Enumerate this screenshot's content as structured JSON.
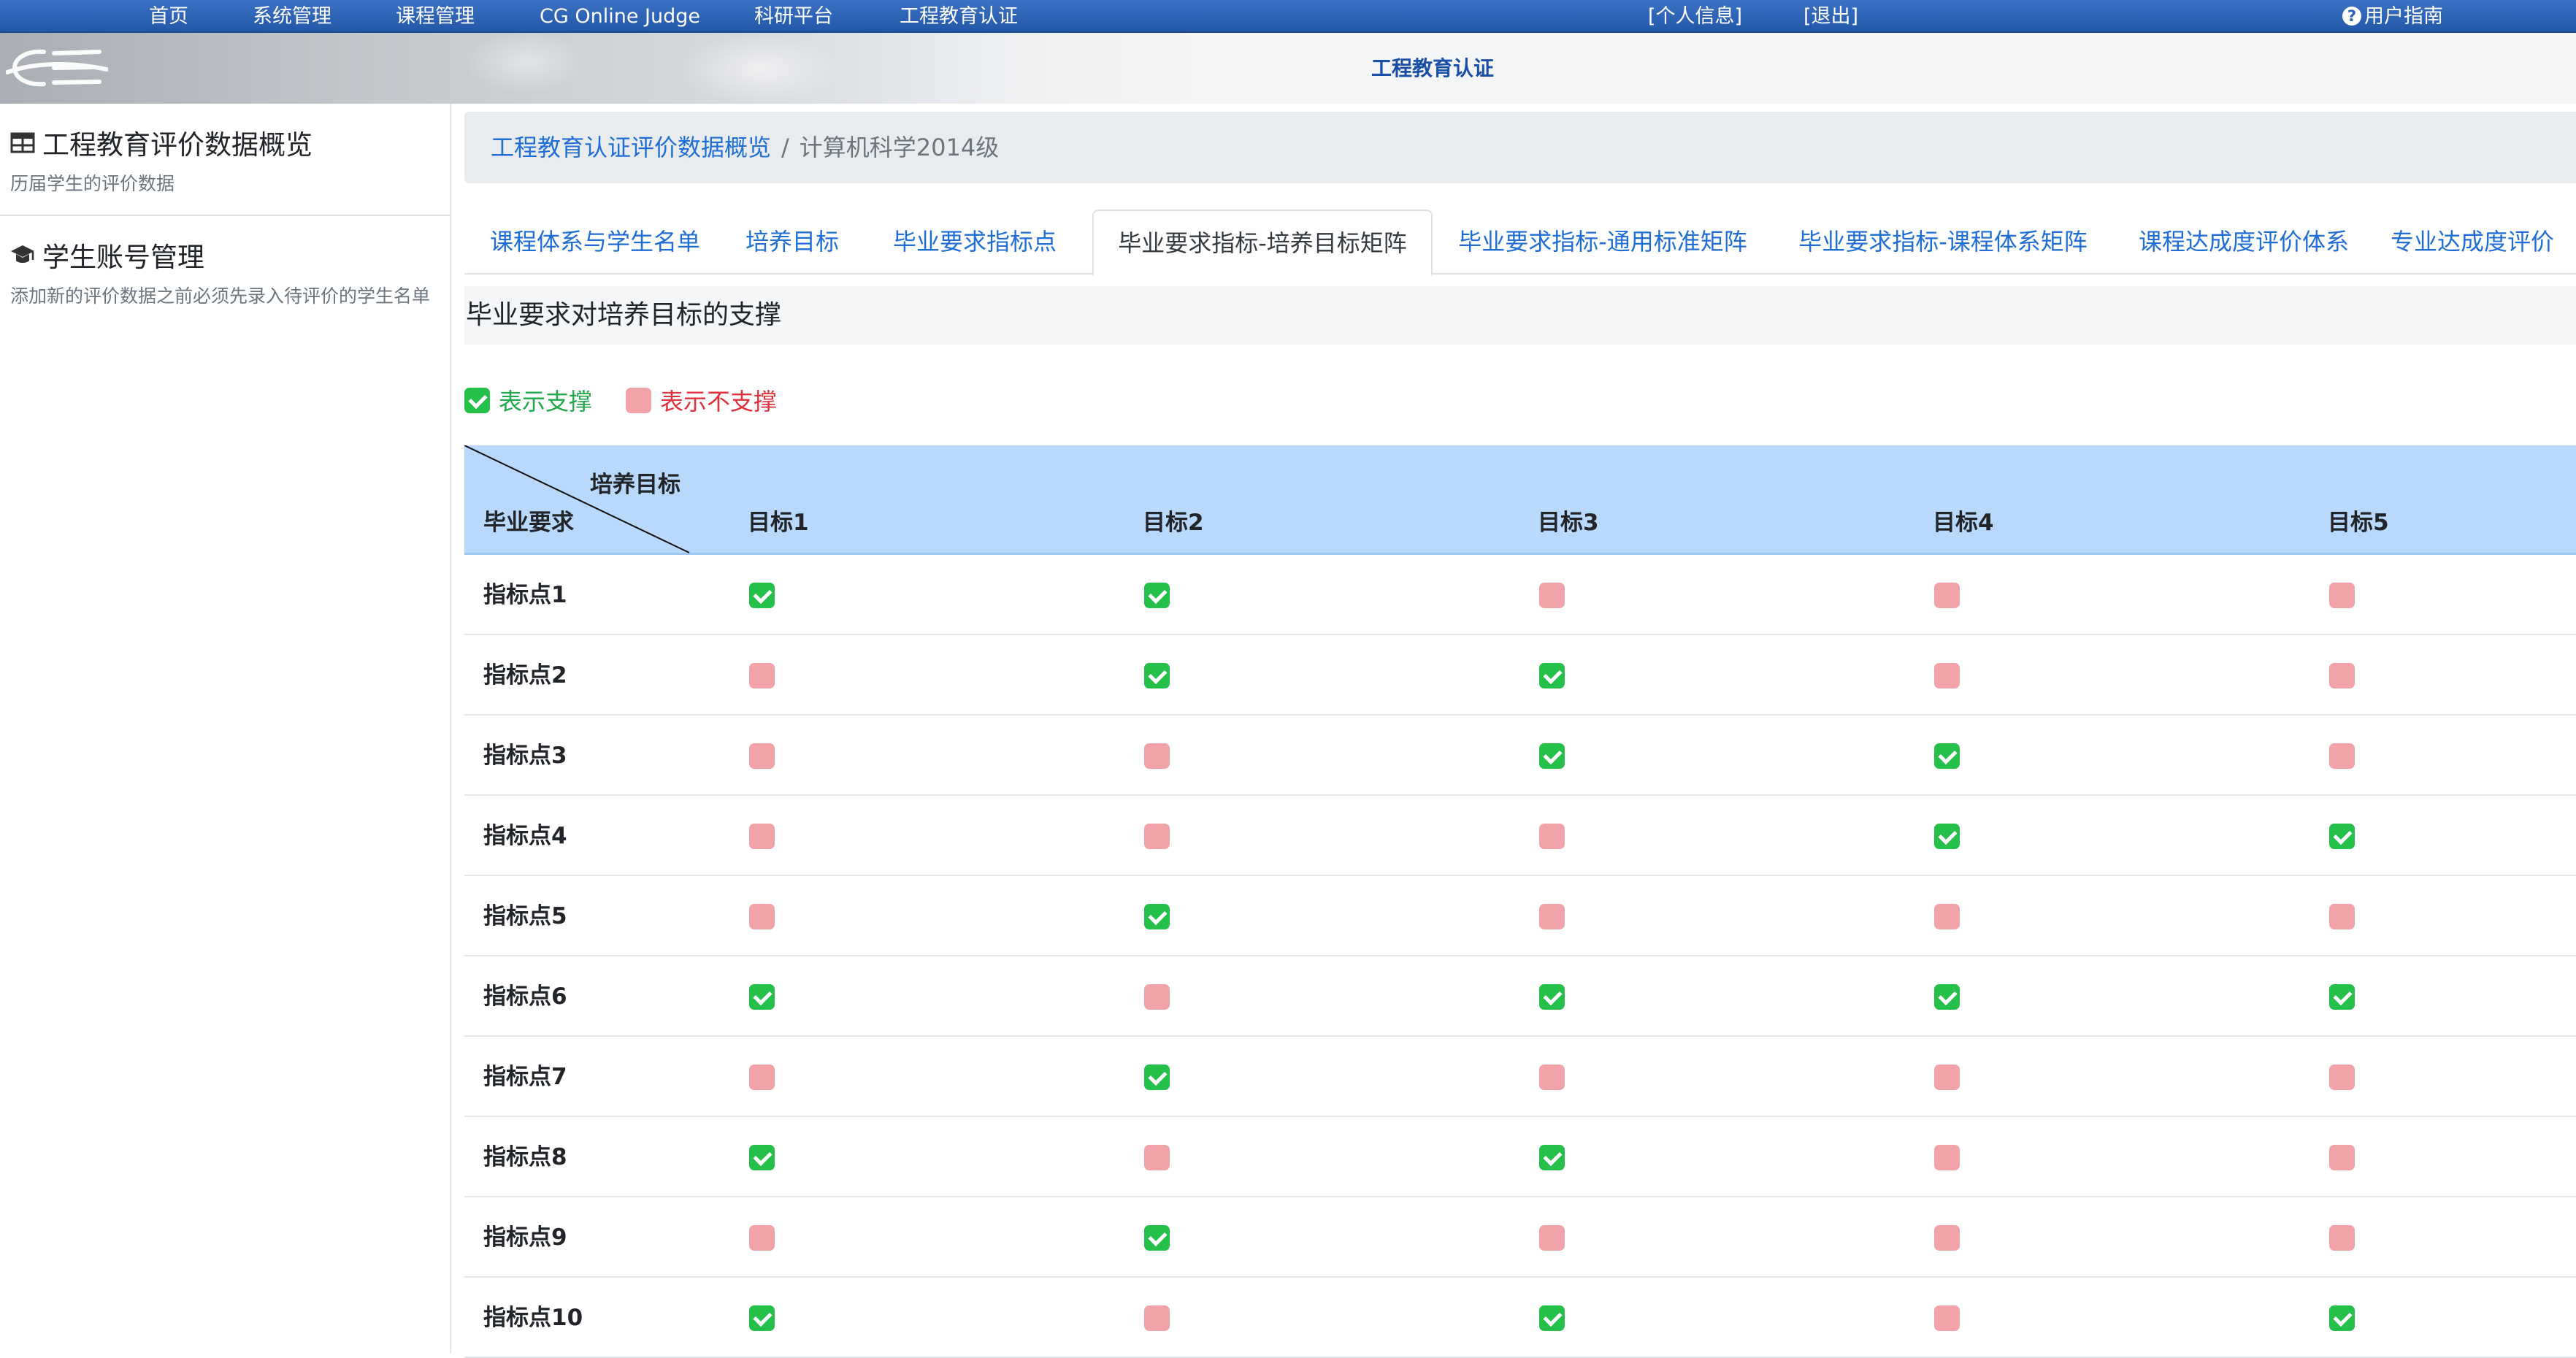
{
  "topnav": {
    "items": [
      "首页",
      "系统管理",
      "课程管理",
      "CG Online Judge",
      "科研平台",
      "工程教育认证"
    ],
    "profile": "[个人信息]",
    "logout": "[退出]",
    "help": "用户指南"
  },
  "banner": {
    "title": "工程教育认证"
  },
  "sidebar": {
    "overview": {
      "title": "工程教育评价数据概览",
      "subtitle": "历届学生的评价数据"
    },
    "accounts": {
      "title": "学生账号管理",
      "subtitle": "添加新的评价数据之前必须先录入待评价的学生名单"
    }
  },
  "breadcrumb": {
    "link": "工程教育认证评价数据概览",
    "separator": "/",
    "current": "计算机科学2014级"
  },
  "tabs": [
    {
      "label": "课程体系与学生名单",
      "active": false
    },
    {
      "label": "培养目标",
      "active": false
    },
    {
      "label": "毕业要求指标点",
      "active": false
    },
    {
      "label": "毕业要求指标-培养目标矩阵",
      "active": true
    },
    {
      "label": "毕业要求指标-通用标准矩阵",
      "active": false
    },
    {
      "label": "毕业要求指标-课程体系矩阵",
      "active": false
    },
    {
      "label": "课程达成度评价体系",
      "active": false
    },
    {
      "label": "专业达成度评价",
      "active": false
    }
  ],
  "section_title": "毕业要求对培养目标的支撑",
  "legend": {
    "supported": "表示支撑",
    "not_supported": "表示不支撑",
    "supported_color": "#24c04a",
    "not_supported_color": "#f2a3aa"
  },
  "matrix": {
    "corner_top": "培养目标",
    "corner_bottom": "毕业要求",
    "columns": [
      "目标1",
      "目标2",
      "目标3",
      "目标4",
      "目标5"
    ],
    "rows": [
      {
        "label": "指标点1",
        "values": [
          true,
          true,
          false,
          false,
          false
        ]
      },
      {
        "label": "指标点2",
        "values": [
          false,
          true,
          true,
          false,
          false
        ]
      },
      {
        "label": "指标点3",
        "values": [
          false,
          false,
          true,
          true,
          false
        ]
      },
      {
        "label": "指标点4",
        "values": [
          false,
          false,
          false,
          true,
          true
        ]
      },
      {
        "label": "指标点5",
        "values": [
          false,
          true,
          false,
          false,
          false
        ]
      },
      {
        "label": "指标点6",
        "values": [
          true,
          false,
          true,
          true,
          true
        ]
      },
      {
        "label": "指标点7",
        "values": [
          false,
          true,
          false,
          false,
          false
        ]
      },
      {
        "label": "指标点8",
        "values": [
          true,
          false,
          true,
          false,
          false
        ]
      },
      {
        "label": "指标点9",
        "values": [
          false,
          true,
          false,
          false,
          false
        ]
      },
      {
        "label": "指标点10",
        "values": [
          true,
          false,
          true,
          false,
          true
        ]
      }
    ]
  }
}
